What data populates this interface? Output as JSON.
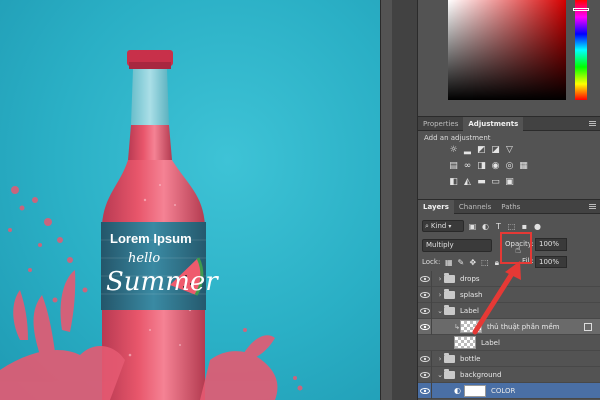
{
  "canvas": {
    "label_title": "Lorem Ipsum",
    "label_script_1": "hello",
    "label_script_2": "Summer"
  },
  "colors": {
    "background": "#2db4c9",
    "liquid": "#e8566b",
    "label_blue": "#2e6f86",
    "highlight": "#e53935"
  },
  "panels": {
    "tabs_top": [
      {
        "label": "Properties",
        "active": false
      },
      {
        "label": "Adjustments",
        "active": true
      }
    ],
    "adjustments": {
      "hint": "Add an adjustment",
      "row1_icons": [
        "brightness-icon",
        "levels-icon",
        "curves-icon",
        "exposure-icon",
        "vibrance-icon"
      ],
      "row2_icons": [
        "hue-sat-icon",
        "color-balance-icon",
        "black-white-icon",
        "photo-filter-icon",
        "channel-mixer-icon",
        "color-lookup-icon"
      ],
      "row3_icons": [
        "invert-icon",
        "posterize-icon",
        "threshold-icon",
        "gradient-map-icon",
        "selective-color-icon"
      ]
    },
    "tabs_layers": [
      {
        "label": "Layers",
        "active": true
      },
      {
        "label": "Channels",
        "active": false
      },
      {
        "label": "Paths",
        "active": false
      }
    ],
    "layers": {
      "kind_label": "Kind",
      "blend_mode": "Multiply",
      "opacity_label": "Opacity:",
      "opacity_value": "100%",
      "lock_label": "Lock:",
      "fill_label": "Fill:",
      "fill_value": "100%",
      "items": [
        {
          "name": "drops",
          "type": "group",
          "indent": 0,
          "selected": false,
          "expanded": false
        },
        {
          "name": "splash",
          "type": "group",
          "indent": 0,
          "selected": false,
          "expanded": false
        },
        {
          "name": "Label",
          "type": "group",
          "indent": 0,
          "selected": false,
          "expanded": true
        },
        {
          "name": "thủ thuật phần mềm",
          "type": "smart",
          "indent": 1,
          "selected": true,
          "expanded": false
        },
        {
          "name": "Label",
          "type": "pixel",
          "indent": 1,
          "selected": false,
          "expanded": false
        },
        {
          "name": "bottle",
          "type": "group",
          "indent": 0,
          "selected": false,
          "expanded": false
        },
        {
          "name": "background",
          "type": "group",
          "indent": 0,
          "selected": false,
          "expanded": true
        },
        {
          "name": "COLOR",
          "type": "fill",
          "indent": 1,
          "selected": false,
          "expanded": false
        }
      ]
    }
  }
}
